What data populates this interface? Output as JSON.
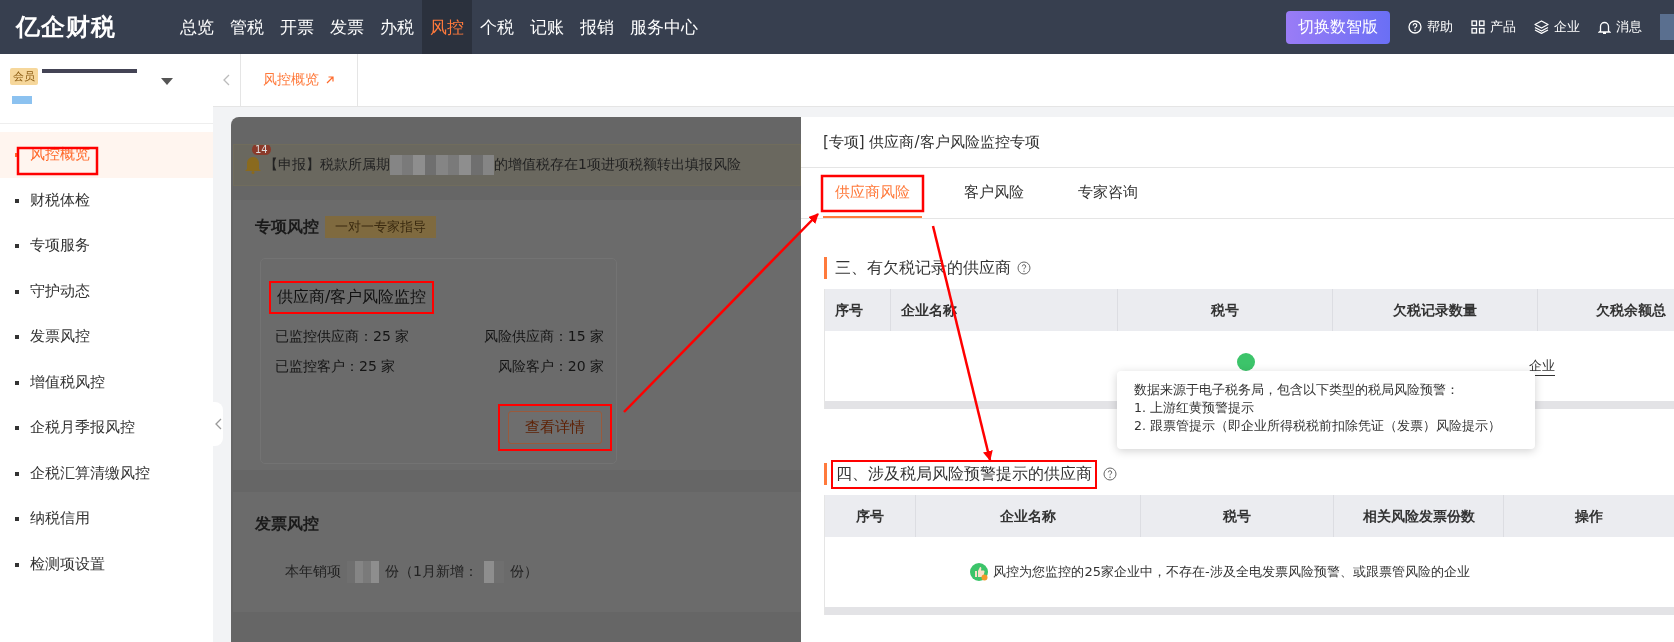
{
  "topbar": {
    "logo": "亿企财税",
    "nav": [
      {
        "label": "总览",
        "selected": false
      },
      {
        "label": "管税",
        "selected": false
      },
      {
        "label": "开票",
        "selected": false
      },
      {
        "label": "发票",
        "selected": false
      },
      {
        "label": "办税",
        "selected": false
      },
      {
        "label": "风控",
        "selected": true
      },
      {
        "label": "个税",
        "selected": false
      },
      {
        "label": "记账",
        "selected": false
      },
      {
        "label": "报销",
        "selected": false
      },
      {
        "label": "服务中心",
        "selected": false
      }
    ],
    "switch_button": "切换数智版",
    "tools": [
      {
        "kind": "help",
        "label": "帮助"
      },
      {
        "kind": "grid",
        "label": "产品"
      },
      {
        "kind": "layers",
        "label": "企业"
      },
      {
        "kind": "bell",
        "label": "消息"
      }
    ]
  },
  "sidebar": {
    "member_badge": "会员",
    "items": [
      {
        "label": "风控概览",
        "selected": true
      },
      {
        "label": "财税体检",
        "selected": false
      },
      {
        "label": "专项服务",
        "selected": false
      },
      {
        "label": "守护动态",
        "selected": false
      },
      {
        "label": "发票风控",
        "selected": false
      },
      {
        "label": "增值税风控",
        "selected": false
      },
      {
        "label": "企税月季报风控",
        "selected": false
      },
      {
        "label": "企税汇算清缴风控",
        "selected": false
      },
      {
        "label": "纳税信用",
        "selected": false
      },
      {
        "label": "检测项设置",
        "selected": false
      }
    ]
  },
  "page_tabs": [
    {
      "label": "风控概览",
      "selected": true
    }
  ],
  "background": {
    "notice": {
      "badge": "14",
      "prefix": "【申报】税款所属期",
      "suffix": "的增值税存在1项进项税额转出填报风险"
    },
    "special_card": {
      "title": "专项风控",
      "tag": "一对一专家指导",
      "monitor": {
        "title": "供应商/客户风险监控",
        "stats": [
          "已监控供应商：25 家",
          "风险供应商：15 家",
          "已监控客户：25 家",
          "风险客户：20 家"
        ],
        "button": "查看详情"
      }
    },
    "invoice_card": {
      "title": "发票风控",
      "line_start": "本年销项",
      "line_mid": "份（1月新增：",
      "line_end": "份）"
    }
  },
  "drawer": {
    "title": "[专项] 供应商/客户风险监控专项",
    "tabs": [
      {
        "label": "供应商风险",
        "selected": true
      },
      {
        "label": "客户风险",
        "selected": false
      },
      {
        "label": "专家咨询",
        "selected": false
      }
    ],
    "section_3": {
      "title": "三、有欠税记录的供应商",
      "columns": [
        "序号",
        "企业名称",
        "税号",
        "欠税记录数量",
        "欠税余额总"
      ],
      "empty_remnant": "企业"
    },
    "tooltip": {
      "lines": [
        "数据来源于电子税务局，包含以下类型的税局风险预警：",
        "1. 上游红黄预警提示",
        "2. 跟票管提示（即企业所得税税前扣除凭证（发票）风险提示）"
      ]
    },
    "section_4": {
      "title": "四、涉及税局风险预警提示的供应商",
      "columns": [
        "序号",
        "企业名称",
        "税号",
        "相关风险发票份数",
        "操作"
      ],
      "empty_message": "风控为您监控的25家企业中，不存在-涉及全电发票风险预警、或跟票管风险的企业"
    }
  }
}
